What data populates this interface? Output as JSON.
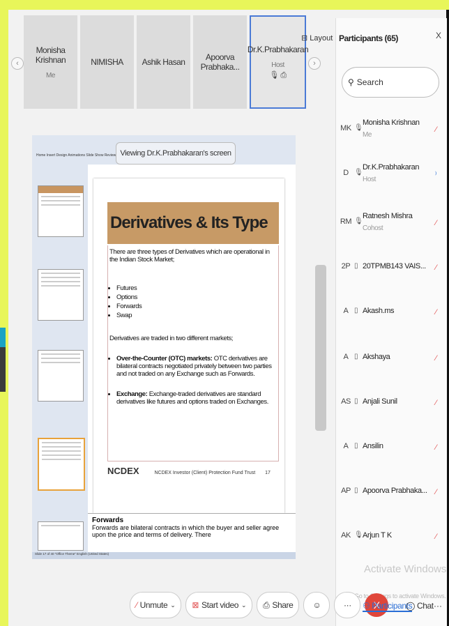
{
  "tiles": [
    {
      "name": "Monisha Krishnan",
      "sub": "Me"
    },
    {
      "name": "NIMISHA",
      "sub": ""
    },
    {
      "name": "Ashik Hasan",
      "sub": ""
    },
    {
      "name": "Apoorva Prabhaka...",
      "sub": ""
    },
    {
      "name": "Dr.K.Prabhakaran",
      "sub": "Host"
    }
  ],
  "layout_label": "Layout",
  "viewing_label": "Viewing Dr.K.Prabhakaran's screen",
  "slide": {
    "title": "Derivatives & Its Type",
    "intro": "There are three types of Derivatives which are operational in the Indian Stock Market;",
    "bullets": [
      "Futures",
      "Options",
      "Forwards",
      "Swap"
    ],
    "markets_text": "Derivatives are traded in two different markets;",
    "otc_label": "Over-the-Counter (OTC) markets:",
    "otc_text": "OTC derivatives are bilateral contracts negotiated privately between two parties and not traded on any Exchange such as Forwards.",
    "exchange_label": "Exchange:",
    "exchange_text": "Exchange-traded derivatives are standard derivatives like futures and options traded on Exchanges.",
    "logo": "NCDEX",
    "footer_org": "NCDEX Investor (Client) Protection Fund Trust",
    "page": "17"
  },
  "notes": {
    "title": "Forwards",
    "text": "Forwards are bilateral contracts in which the buyer and seller agree upon the price and terms of delivery. There"
  },
  "ppt_status": "Slide 17 of 40   \"Office Theme\"   English (United States)",
  "panel": {
    "title": "Participants (65)",
    "close": "X",
    "search_placeholder": "Search",
    "participants": [
      {
        "initials": "MK",
        "name": "Monisha Krishnan",
        "role": "Me"
      },
      {
        "initials": "D",
        "name": "Dr.K.Prabhakaran",
        "role": "Host"
      },
      {
        "initials": "RM",
        "name": "Ratnesh Mishra",
        "role": "Cohost"
      },
      {
        "initials": "2P",
        "name": "20TPMB143 VAIS...",
        "role": ""
      },
      {
        "initials": "A",
        "name": "Akash.ms",
        "role": ""
      },
      {
        "initials": "A",
        "name": "Akshaya",
        "role": ""
      },
      {
        "initials": "AS",
        "name": "Anjali Sunil",
        "role": ""
      },
      {
        "initials": "A",
        "name": "Ansilin",
        "role": ""
      },
      {
        "initials": "AP",
        "name": "Apoorva Prabhaka...",
        "role": ""
      },
      {
        "initials": "AK",
        "name": "Arjun T K",
        "role": ""
      }
    ]
  },
  "watermark": "Activate Windows",
  "watermark_sub": "Go to Settings to activate Windows.",
  "toolbar": {
    "unmute": "Unmute",
    "start_video": "Start video",
    "share": "Share",
    "participants": "Participants",
    "chat": "Chat",
    "more": "···"
  }
}
